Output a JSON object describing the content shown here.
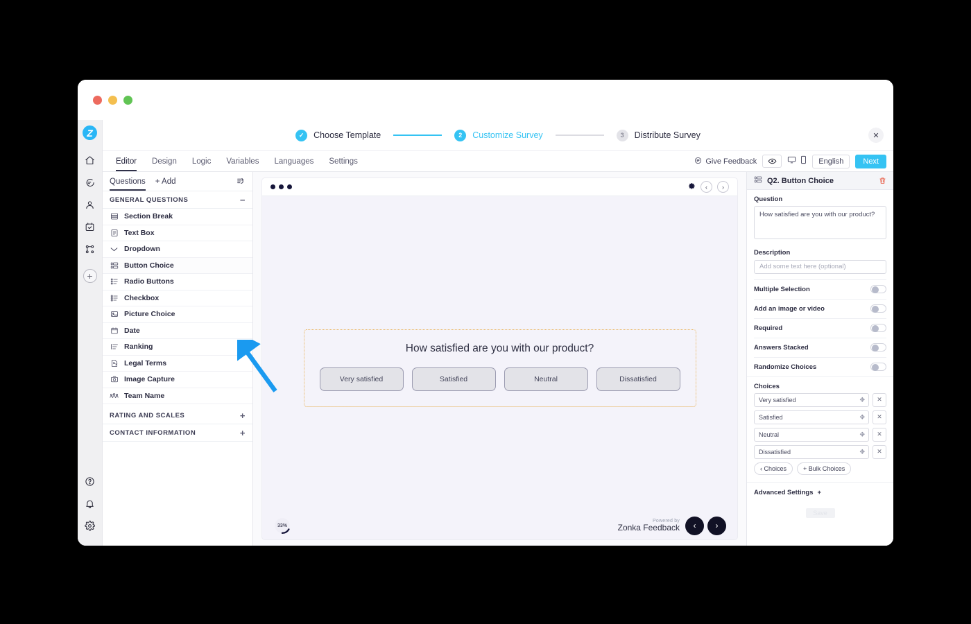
{
  "window": {
    "traffic_lights": [
      "close",
      "minimize",
      "zoom"
    ],
    "colors": {
      "red": "#ed6a5e",
      "yellow": "#f4bf4f",
      "green": "#61c454",
      "accent": "#35c3f3",
      "delete": "#e8573f",
      "highlight_border": "#e9b45c"
    }
  },
  "rail": {
    "logo_letter": "Z",
    "items": [
      {
        "name": "home-icon"
      },
      {
        "name": "feedback-icon"
      },
      {
        "name": "contacts-icon"
      },
      {
        "name": "tasks-icon"
      },
      {
        "name": "workflows-icon"
      }
    ],
    "add_label": "+",
    "bottom_items": [
      {
        "name": "help-icon"
      },
      {
        "name": "notifications-icon"
      },
      {
        "name": "settings-icon"
      }
    ]
  },
  "wizard": {
    "steps": [
      {
        "badge": "✓",
        "label": "Choose Template",
        "state": "done"
      },
      {
        "badge": "2",
        "label": "Customize Survey",
        "state": "active"
      },
      {
        "badge": "3",
        "label": "Distribute Survey",
        "state": "todo"
      }
    ],
    "close_label": "✕"
  },
  "tabs": {
    "items": [
      {
        "label": "Editor",
        "active": true
      },
      {
        "label": "Design",
        "active": false
      },
      {
        "label": "Logic",
        "active": false
      },
      {
        "label": "Variables",
        "active": false
      },
      {
        "label": "Languages",
        "active": false
      },
      {
        "label": "Settings",
        "active": false
      }
    ],
    "give_feedback": "Give Feedback",
    "language": "English",
    "next": "Next"
  },
  "questions_panel": {
    "tab_questions": "Questions",
    "tab_add": "+ Add",
    "groups": [
      {
        "title": "GENERAL QUESTIONS",
        "sign": "−",
        "items": [
          {
            "label": "Section Break",
            "icon": "section-break-icon"
          },
          {
            "label": "Text Box",
            "icon": "text-box-icon"
          },
          {
            "label": "Dropdown",
            "icon": "dropdown-icon"
          },
          {
            "label": "Button Choice",
            "icon": "button-choice-icon"
          },
          {
            "label": "Radio Buttons",
            "icon": "radio-buttons-icon"
          },
          {
            "label": "Checkbox",
            "icon": "checkbox-icon"
          },
          {
            "label": "Picture Choice",
            "icon": "picture-choice-icon"
          },
          {
            "label": "Date",
            "icon": "date-icon"
          },
          {
            "label": "Ranking",
            "icon": "ranking-icon"
          },
          {
            "label": "Legal Terms",
            "icon": "legal-terms-icon"
          },
          {
            "label": "Image Capture",
            "icon": "image-capture-icon"
          },
          {
            "label": "Team Name",
            "icon": "team-name-icon"
          }
        ]
      },
      {
        "title": "RATING AND SCALES",
        "sign": "+",
        "items": []
      },
      {
        "title": "CONTACT INFORMATION",
        "sign": "+",
        "items": []
      }
    ]
  },
  "preview": {
    "question_title": "How satisfied are you with our product?",
    "choices": [
      "Very satisfied",
      "Satisfied",
      "Neutral",
      "Dissatisfied"
    ],
    "progress": "33%",
    "progress_value": 33,
    "powered_by": "Powered by",
    "brand": "Zonka Feedback",
    "prev_label": "‹",
    "next_label": "›"
  },
  "settings_panel": {
    "title": "Q2. Button Choice",
    "question_label": "Question",
    "question_value": "How satisfied are you with our product?",
    "description_label": "Description",
    "description_placeholder": "Add some text here (optional)",
    "toggles": [
      {
        "label": "Multiple Selection",
        "on": false
      },
      {
        "label": "Add an image or video",
        "on": false
      },
      {
        "label": "Required",
        "on": false
      },
      {
        "label": "Answers Stacked",
        "on": false
      },
      {
        "label": "Randomize Choices",
        "on": false
      }
    ],
    "choices_label": "Choices",
    "choices": [
      "Very satisfied",
      "Satisfied",
      "Neutral",
      "Dissatisfied"
    ],
    "add_choices": "‹ Choices",
    "add_bulk": "+ Bulk Choices",
    "advanced_settings": "Advanced Settings",
    "advanced_sign": "+",
    "save_label": "Save"
  }
}
